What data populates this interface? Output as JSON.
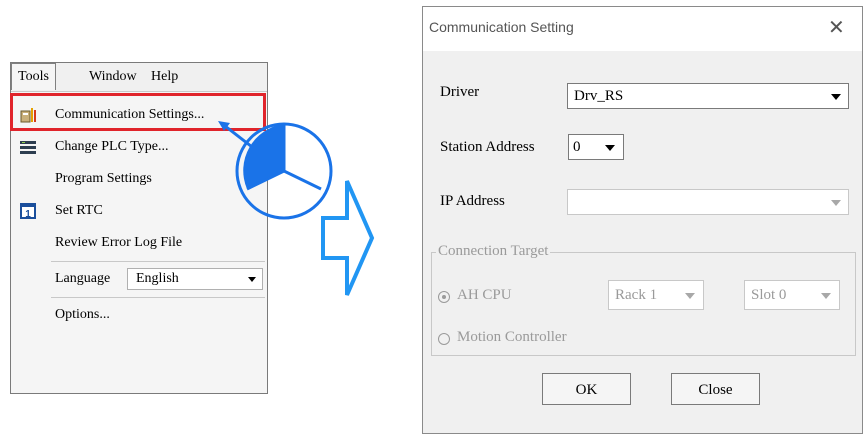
{
  "menubar": {
    "items": [
      "Tools",
      "Window",
      "Help"
    ]
  },
  "tools_menu": {
    "items": [
      {
        "label": "Communication Settings...",
        "icon": "communication-settings-icon"
      },
      {
        "label": "Change PLC Type...",
        "icon": "plc-type-icon"
      },
      {
        "label": "Program Settings",
        "submenu": true
      },
      {
        "label": "Set RTC",
        "icon": "calendar-icon"
      },
      {
        "label": "Review Error Log File"
      },
      {
        "label": "Language",
        "value": "English"
      },
      {
        "label": "Options..."
      }
    ]
  },
  "dialog": {
    "title": "Communication Setting",
    "driver": {
      "label": "Driver",
      "value": "Drv_RS"
    },
    "station_address": {
      "label": "Station Address",
      "value": "0"
    },
    "ip_address": {
      "label": "IP Address",
      "value": ""
    },
    "connection_target": {
      "label": "Connection Target",
      "ah_cpu": "AH CPU",
      "rack": "Rack 1",
      "slot": "Slot 0",
      "motion_controller": "Motion Controller"
    },
    "ok_label": "OK",
    "close_label": "Close"
  },
  "colors": {
    "highlight": "#e0242b",
    "pointer": "#1a73e8",
    "arrow_fill": "#ffffff",
    "arrow_stroke": "#2196f3"
  }
}
